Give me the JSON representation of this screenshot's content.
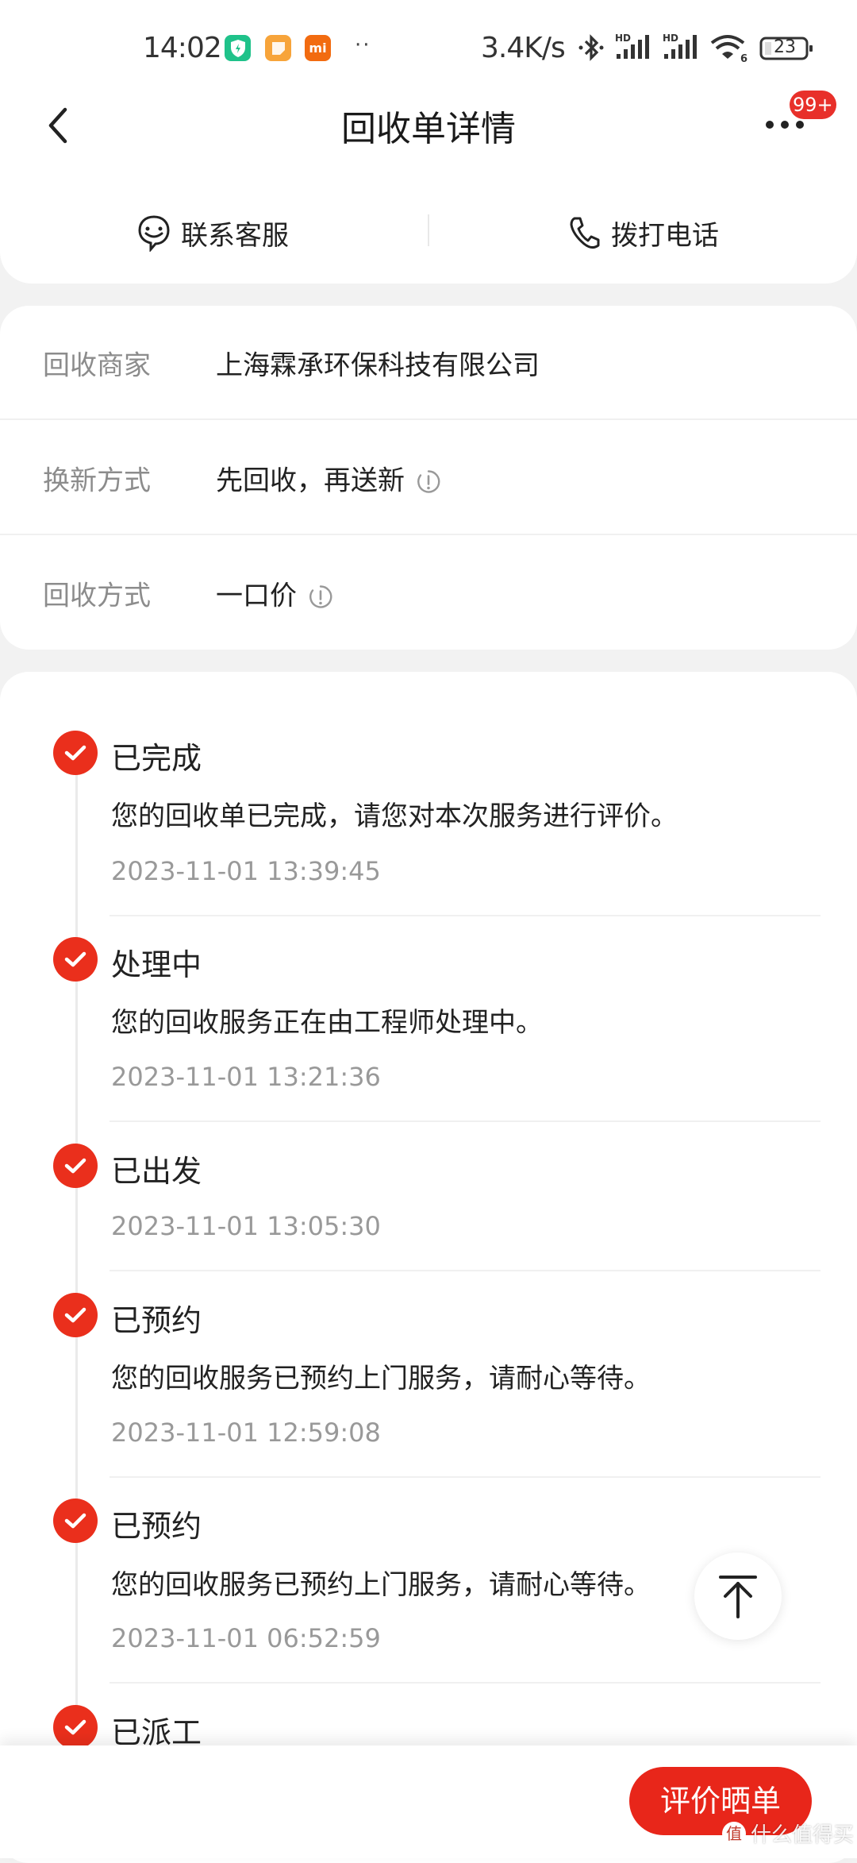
{
  "status_bar": {
    "time": "14:02",
    "notification_apps": [
      {
        "icon": "security-shield-icon",
        "color": "#1fc28a"
      },
      {
        "icon": "notes-icon",
        "color": "#f7a43a"
      },
      {
        "icon": "mi-icon",
        "color": "#f26b10",
        "label": "mi"
      }
    ],
    "more_dots": "··",
    "net_speed": "3.4K/s",
    "battery": "23",
    "icons": [
      "bluetooth-icon",
      "signal-hd-icon",
      "signal-hd-icon",
      "wifi-6-icon",
      "battery-icon"
    ]
  },
  "header": {
    "title": "回收单详情",
    "back_icon": "chevron-left-icon",
    "more_icon": "more-dots-icon",
    "badge": "99+"
  },
  "actions": [
    {
      "label": "联系客服",
      "icon": "customer-service-chat-icon"
    },
    {
      "label": "拨打电话",
      "icon": "phone-icon"
    }
  ],
  "info": [
    {
      "label": "回收商家",
      "value": "上海霖承环保科技有限公司",
      "has_info_icon": false
    },
    {
      "label": "换新方式",
      "value": "先回收，再送新",
      "has_info_icon": true
    },
    {
      "label": "回收方式",
      "value": "一口价",
      "has_info_icon": true
    }
  ],
  "timeline": [
    {
      "status": "已完成",
      "desc": "您的回收单已完成，请您对本次服务进行评价。",
      "time": "2023-11-01 13:39:45"
    },
    {
      "status": "处理中",
      "desc": "您的回收服务正在由工程师处理中。",
      "time": "2023-11-01 13:21:36"
    },
    {
      "status": "已出发",
      "desc": "",
      "time": "2023-11-01 13:05:30"
    },
    {
      "status": "已预约",
      "desc": "您的回收服务已预约上门服务，请耐心等待。",
      "time": "2023-11-01 12:59:08"
    },
    {
      "status": "已预约",
      "desc": "您的回收服务已预约上门服务，请耐心等待。",
      "time": "2023-11-01 06:52:59"
    },
    {
      "status": "已派工",
      "desc": "",
      "time": ""
    }
  ],
  "bottom": {
    "review_button": "评价晒单",
    "watermark_logo": "值",
    "watermark": "什么值得买"
  },
  "colors": {
    "accent": "#e8261a",
    "check": "#ea2f1c",
    "label_gray": "#8c8c8c",
    "time_gray": "#999999"
  }
}
